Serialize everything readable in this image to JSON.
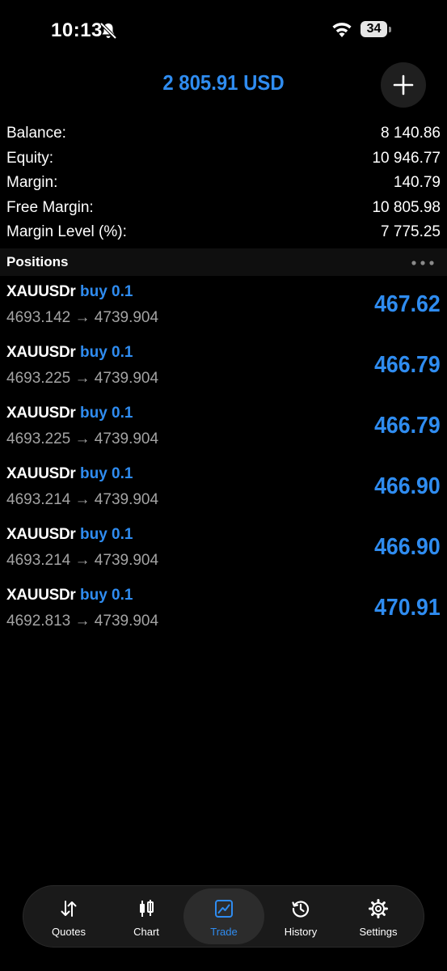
{
  "status_bar": {
    "time": "10:13",
    "battery": "34"
  },
  "header": {
    "total": "2 805.91 USD"
  },
  "summary": [
    {
      "label": "Balance:",
      "value": "8 140.86"
    },
    {
      "label": "Equity:",
      "value": "10 946.77"
    },
    {
      "label": "Margin:",
      "value": "140.79"
    },
    {
      "label": "Free Margin:",
      "value": "10 805.98"
    },
    {
      "label": "Margin Level (%):",
      "value": "7 775.25"
    }
  ],
  "positions_title": "Positions",
  "positions": [
    {
      "symbol": "XAUUSDr",
      "side": "buy 0.1",
      "prices": "4693.142 → 4739.904",
      "profit": "467.62"
    },
    {
      "symbol": "XAUUSDr",
      "side": "buy 0.1",
      "prices": "4693.225 → 4739.904",
      "profit": "466.79"
    },
    {
      "symbol": "XAUUSDr",
      "side": "buy 0.1",
      "prices": "4693.225 → 4739.904",
      "profit": "466.79"
    },
    {
      "symbol": "XAUUSDr",
      "side": "buy 0.1",
      "prices": "4693.214 → 4739.904",
      "profit": "466.90"
    },
    {
      "symbol": "XAUUSDr",
      "side": "buy 0.1",
      "prices": "4693.214 → 4739.904",
      "profit": "466.90"
    },
    {
      "symbol": "XAUUSDr",
      "side": "buy 0.1",
      "prices": "4692.813 → 4739.904",
      "profit": "470.91"
    }
  ],
  "nav": [
    {
      "label": "Quotes",
      "icon": "quotes-arrows-icon"
    },
    {
      "label": "Chart",
      "icon": "candlestick-icon"
    },
    {
      "label": "Trade",
      "icon": "trade-chart-icon",
      "active": true
    },
    {
      "label": "History",
      "icon": "history-clock-icon"
    },
    {
      "label": "Settings",
      "icon": "gear-icon"
    }
  ],
  "colors": {
    "accent": "#2f8cf0",
    "background": "#000000",
    "secondary_text": "#a3a3a3"
  }
}
